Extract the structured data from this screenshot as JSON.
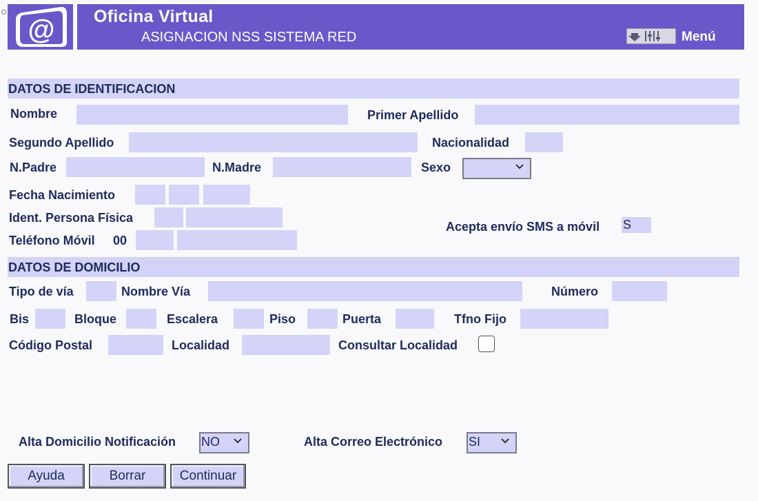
{
  "header": {
    "title": "Oficina Virtual",
    "subtitle": "ASIGNACION NSS SISTEMA RED",
    "menu_label": "Menú",
    "logo_icon": "at-sign-logo-icon",
    "menu_icon": "menu-controls-icon",
    "brand_color": "#6a57c9"
  },
  "identificacion": {
    "title": "DATOS DE IDENTIFICACION",
    "nombre_label": "Nombre",
    "primer_apellido_label": "Primer Apellido",
    "segundo_apellido_label": "Segundo Apellido",
    "nacionalidad_label": "Nacionalidad",
    "padre_label": "N.Padre",
    "madre_label": "N.Madre",
    "sexo_label": "Sexo",
    "sexo_value": "",
    "fecha_label": "Fecha Nacimiento",
    "ident_label": "Ident. Persona Física",
    "telefono_label": "Teléfono Móvil",
    "telefono_prefix": "00",
    "sms_label": "Acepta envío SMS a móvil",
    "sms_value": "S"
  },
  "domicilio": {
    "title": "DATOS DE DOMICILIO",
    "tipo_via_label": "Tipo de vía",
    "nombre_via_label": "Nombre Vía",
    "numero_label": "Número",
    "bis_label": "Bis",
    "bloque_label": "Bloque",
    "escalera_label": "Escalera",
    "piso_label": "Piso",
    "puerta_label": "Puerta",
    "tfno_fijo_label": "Tfno Fijo",
    "cp_label": "Código Postal",
    "localidad_label": "Localidad",
    "consultar_label": "Consultar Localidad"
  },
  "altas": {
    "notificacion_label": "Alta Domicilio Notificación",
    "notificacion_value": "NO",
    "correo_label": "Alta Correo Electrónico",
    "correo_value": "SI"
  },
  "buttons": {
    "ayuda": "Ayuda",
    "borrar": "Borrar",
    "continuar": "Continuar"
  },
  "colors": {
    "field_bg": "#d3d4f7",
    "label_text": "#1f2a5c"
  }
}
